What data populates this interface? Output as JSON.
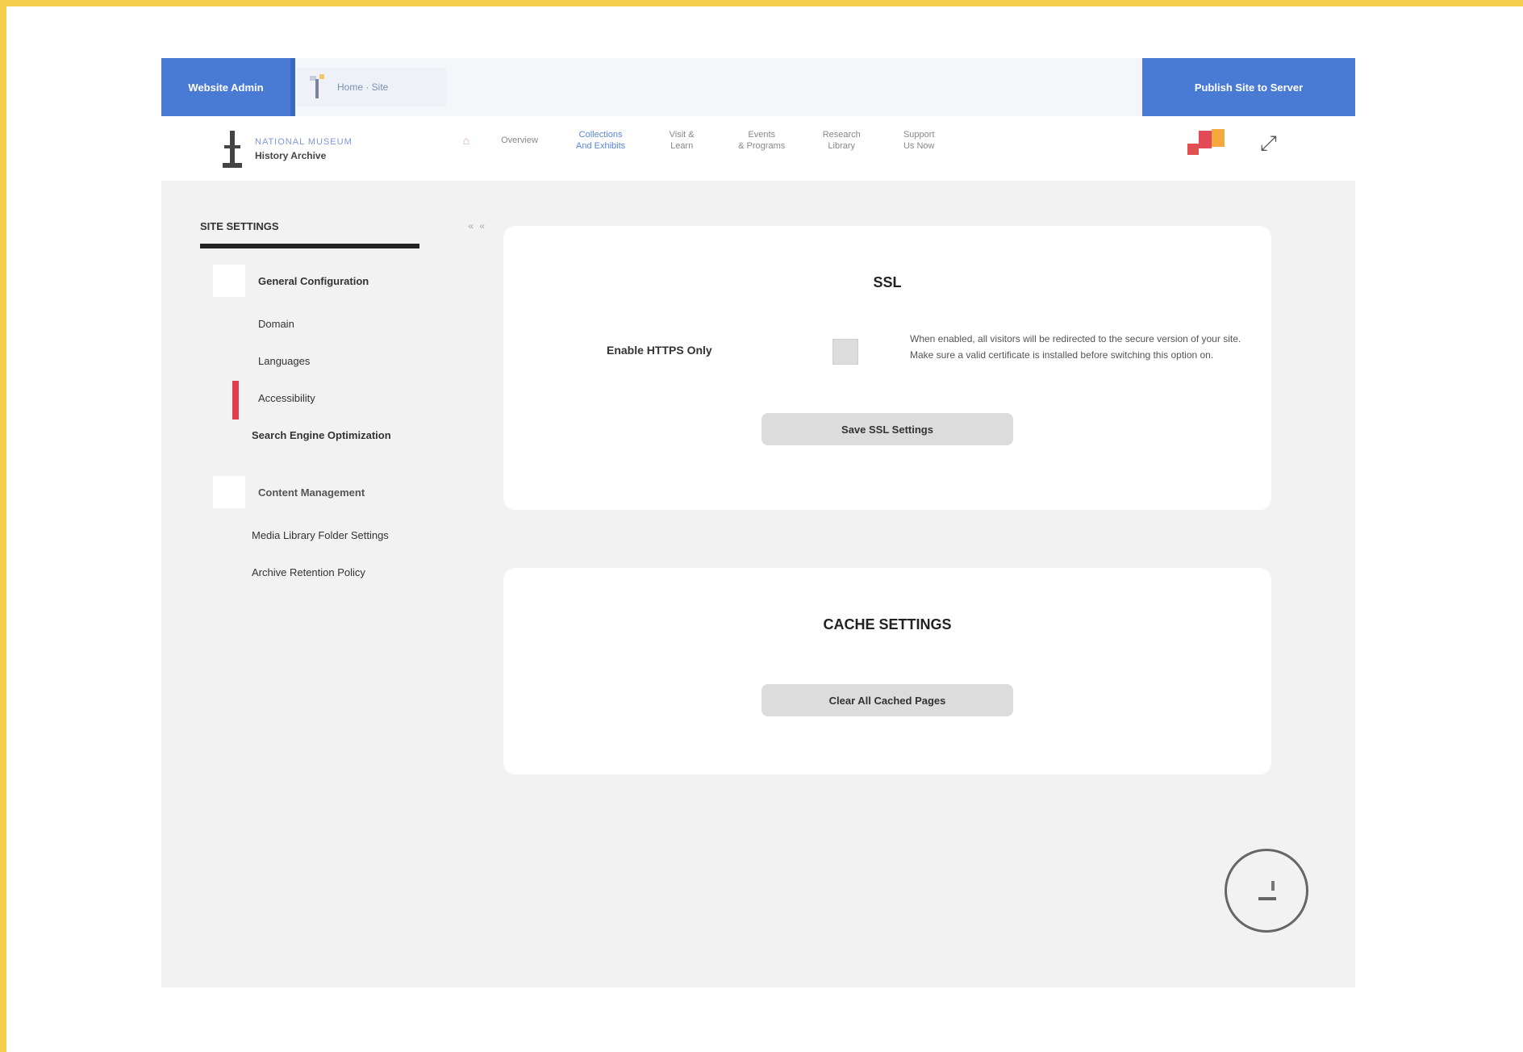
{
  "topbar": {
    "left_tab": "Website Admin",
    "crumb_text": "Home · Site",
    "right_button": "Publish Site to Server"
  },
  "brand": {
    "line1": "NATIONAL MUSEUM",
    "line2": "History Archive"
  },
  "nav": {
    "items": [
      {
        "label": "Overview",
        "active": false
      },
      {
        "label": "Collections\nAnd Exhibits",
        "active": true
      },
      {
        "label": "Visit &\nLearn",
        "active": false
      },
      {
        "label": "Events\n& Programs",
        "active": false
      },
      {
        "label": "Research\nLibrary",
        "active": false
      },
      {
        "label": "Support\nUs Now",
        "active": false
      }
    ],
    "expand_icon": "expand-icon"
  },
  "sidebar": {
    "title": "SITE SETTINGS",
    "collapse": "« «",
    "group1": "General Configuration",
    "items1": [
      "Domain",
      "Languages",
      "Accessibility",
      "Search Engine Optimization"
    ],
    "group2": "Content Management",
    "items2": [
      "Media Library Folder Settings",
      "Archive Retention Policy"
    ]
  },
  "card1": {
    "title": "SSL",
    "field_label": "Enable HTTPS Only",
    "help_text": "When enabled, all visitors will be redirected to the secure version of your site. Make sure a valid certificate is installed before switching this option on.",
    "button": "Save SSL Settings"
  },
  "card2": {
    "title": "CACHE SETTINGS",
    "button": "Clear All Cached Pages"
  },
  "colors": {
    "accent_blue": "#4a7bd4",
    "frame_yellow": "#f7cf4e",
    "active_red": "#e0404e"
  }
}
